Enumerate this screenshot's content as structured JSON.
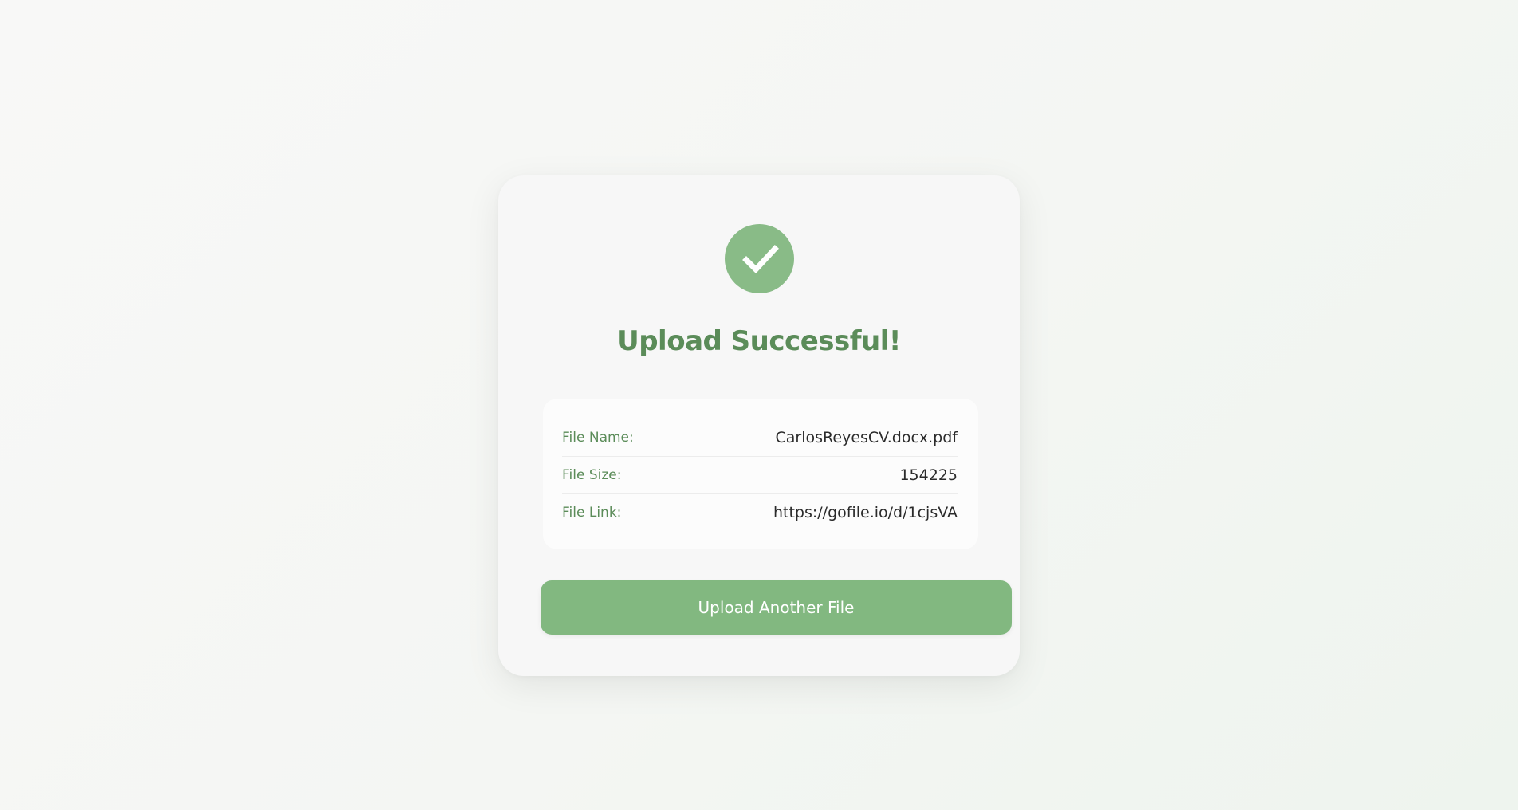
{
  "card": {
    "title": "Upload Successful!",
    "icon": "check-circle-icon",
    "accent_color": "#89bb87"
  },
  "file_info": {
    "rows": [
      {
        "label": "File Name:",
        "value": "CarlosReyesCV.docx.pdf"
      },
      {
        "label": "File Size:",
        "value": "154225"
      },
      {
        "label": "File Link:",
        "value": "https://gofile.io/d/1cjsVA"
      }
    ]
  },
  "actions": {
    "upload_another_label": "Upload Another File",
    "button_color": "#82b880"
  }
}
